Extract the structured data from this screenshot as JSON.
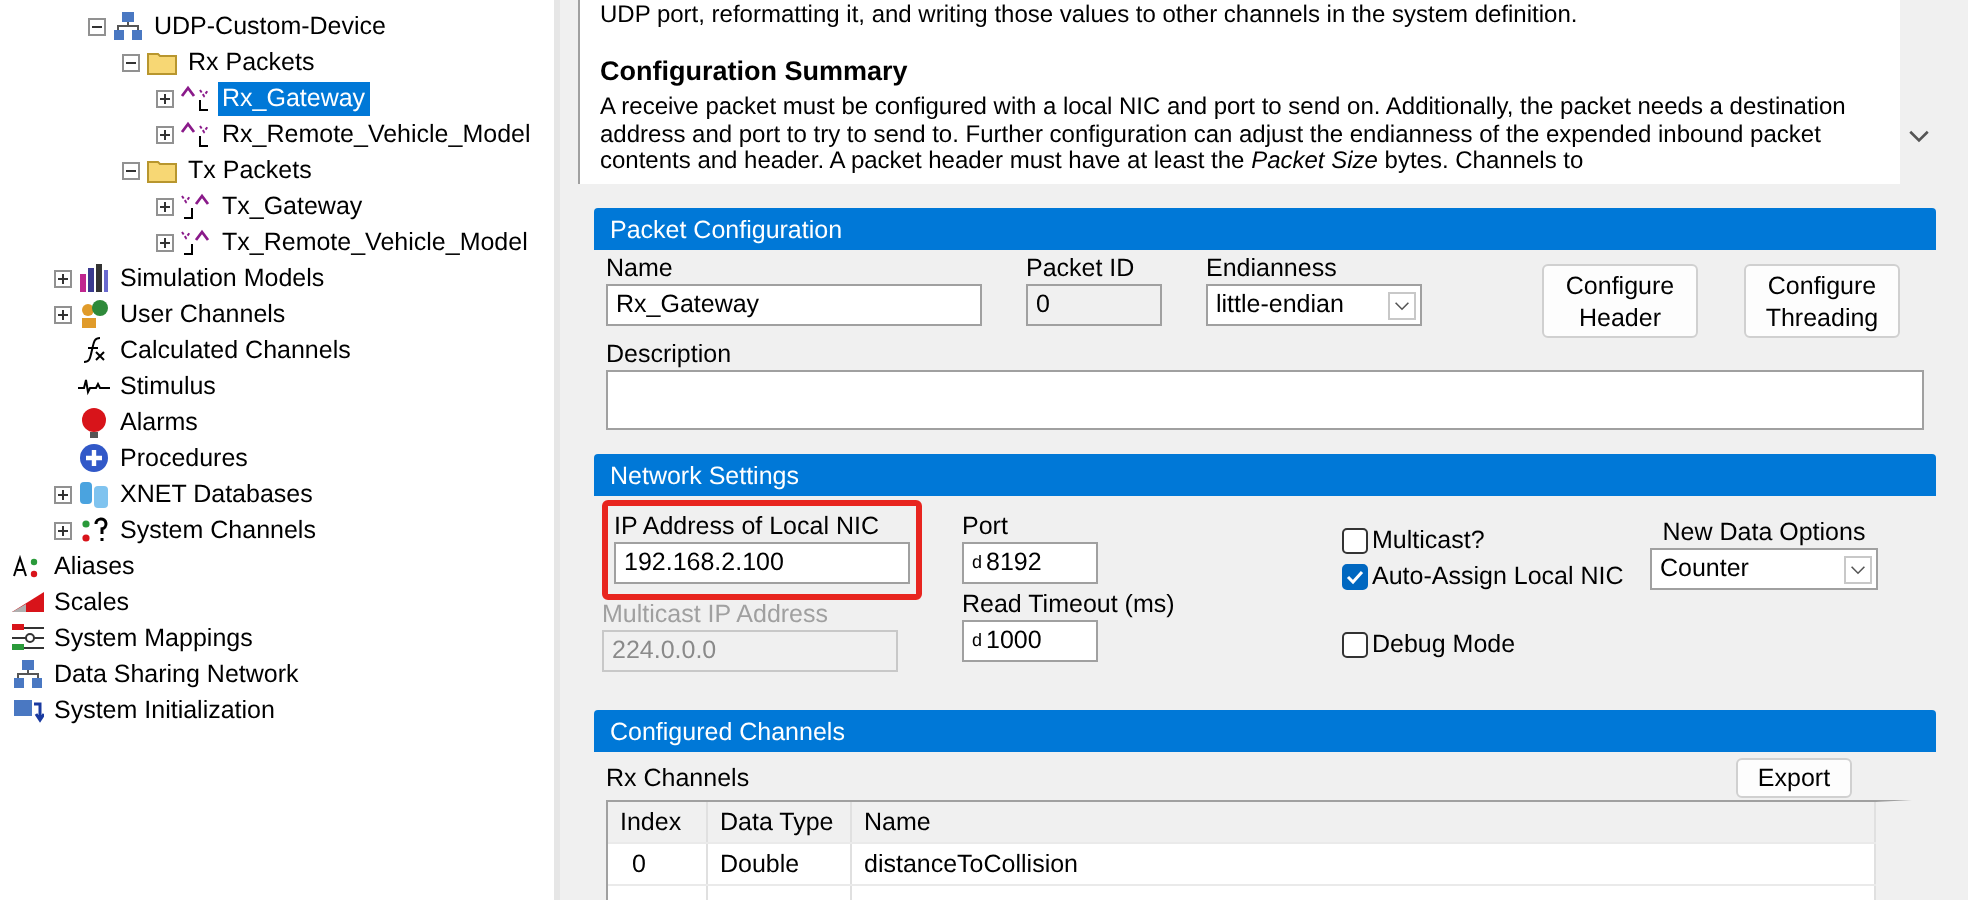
{
  "tree": {
    "items": [
      {
        "children": [
          {
            "children": [
              {
                "label": "UDP-Custom-Device",
                "kind": "device",
                "expanded": true,
                "selected": false,
                "children": [
                  {
                    "label": "Rx Packets",
                    "kind": "folder",
                    "expanded": true,
                    "selected": false,
                    "children": [
                      {
                        "label": "Rx_Gateway",
                        "kind": "rx_packet",
                        "expanded": false,
                        "selected": true
                      },
                      {
                        "label": "Rx_Remote_Vehicle_Model",
                        "kind": "rx_packet",
                        "expanded": false,
                        "selected": false
                      }
                    ]
                  },
                  {
                    "label": "Tx Packets",
                    "kind": "folder",
                    "expanded": true,
                    "selected": false,
                    "children": [
                      {
                        "label": "Tx_Gateway",
                        "kind": "tx_packet",
                        "expanded": false,
                        "selected": false
                      },
                      {
                        "label": "Tx_Remote_Vehicle_Model",
                        "kind": "tx_packet",
                        "expanded": false,
                        "selected": false
                      }
                    ]
                  }
                ]
              }
            ]
          },
          {
            "label": "Simulation Models",
            "kind": "models",
            "expanded": false,
            "selected": false
          },
          {
            "label": "User Channels",
            "kind": "user_channels",
            "expanded": false,
            "selected": false
          },
          {
            "label": "Calculated Channels",
            "kind": "calculated",
            "selected": false
          },
          {
            "label": "Stimulus",
            "kind": "stimulus",
            "selected": false
          },
          {
            "label": "Alarms",
            "kind": "alarms",
            "selected": false
          },
          {
            "label": "Procedures",
            "kind": "procedures",
            "selected": false
          },
          {
            "label": "XNET Databases",
            "kind": "xnet",
            "expanded": false,
            "selected": false
          },
          {
            "label": "System Channels",
            "kind": "system_channels",
            "expanded": false,
            "selected": false
          }
        ]
      },
      {
        "label": "Aliases",
        "kind": "aliases",
        "selected": false
      },
      {
        "label": "Scales",
        "kind": "scales",
        "selected": false
      },
      {
        "label": "System Mappings",
        "kind": "mappings",
        "selected": false
      },
      {
        "label": "Data Sharing Network",
        "kind": "network",
        "selected": false
      },
      {
        "label": "System Initialization",
        "kind": "init",
        "selected": false
      }
    ]
  },
  "description_panel": {
    "paragraphs": [
      {
        "kind": "text",
        "text": "UDP port, reformatting it, and writing those values to other channels in the system definition."
      },
      {
        "kind": "heading",
        "text": "Configuration Summary"
      },
      {
        "kind": "text",
        "text": "A receive packet must be configured with a local NIC and port to send on. Additionally, the packet needs a destination address and port to try to send to. Further configuration can adjust the endianness of the expended inbound packet contents and header. A packet header must have at least the *Packet Size* bytes. Channels to"
      }
    ]
  },
  "packet_configuration": {
    "title": "Packet Configuration",
    "name": {
      "label": "Name",
      "value": "Rx_Gateway"
    },
    "packet_id": {
      "label": "Packet ID",
      "value": "0"
    },
    "endianness": {
      "label": "Endianness",
      "value": "little-endian"
    },
    "buttons": [
      "Configure Header",
      "Configure Threading"
    ],
    "description": {
      "label": "Description"
    }
  },
  "network_settings": {
    "title": "Network Settings",
    "local_nic": {
      "label": "IP Address of Local NIC",
      "value": "192.168.2.100",
      "highlighted": true
    },
    "multicast_address": {
      "label": "Multicast IP Address",
      "value": "224.0.0.0",
      "disabled": true
    },
    "port": {
      "label": "Port",
      "format": "d",
      "value": "8192"
    },
    "read_timeout": {
      "label": "Read Timeout (ms)",
      "format": "d",
      "value": "1000"
    },
    "checkboxes": [
      {
        "label": "Multicast?",
        "checked": false
      },
      {
        "label": "Auto-Assign Local NIC",
        "checked": true
      },
      {
        "label": "Debug Mode",
        "checked": false
      }
    ],
    "new_data_options": {
      "label": "New Data Options",
      "value": "Counter"
    }
  },
  "configured_channels": {
    "title": "Configured Channels",
    "list_label": "Rx Channels",
    "export_button": "Export",
    "columns": [
      "Index",
      "Data Type",
      "Name"
    ],
    "rows": [
      [
        "0",
        "Double",
        "distanceToCollision"
      ]
    ]
  }
}
